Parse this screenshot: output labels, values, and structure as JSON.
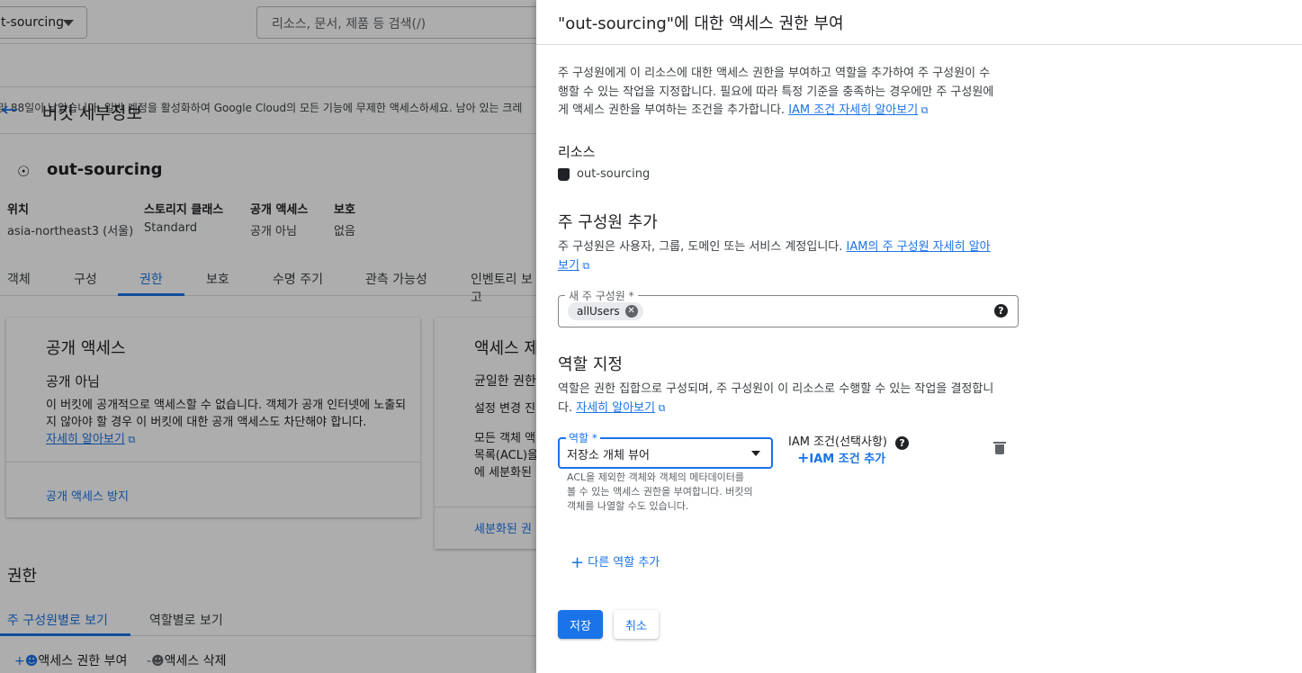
{
  "background": {
    "project_selector": "t-sourcing",
    "search_placeholder": "리소스, 문서, 제품 등 검색(/)",
    "trial_banner": "및 88일이 남았습니다. 일반 계정을 활성화하여 Google Cloud의 모든 기능에 무제한 액세스하세요. 남아 있는 크레",
    "page_title": "버킷 세부정보",
    "bucket_name": "out-sourcing",
    "info": [
      {
        "label": "위치",
        "value": "asia-northeast3 (서울)"
      },
      {
        "label": "스토리지 클래스",
        "value": "Standard"
      },
      {
        "label": "공개 액세스",
        "value": "공개 아님"
      },
      {
        "label": "보호",
        "value": "없음"
      }
    ],
    "tabs": [
      "객체",
      "구성",
      "권한",
      "보호",
      "수명 주기",
      "관측 가능성",
      "인벤토리 보고"
    ],
    "card1": {
      "title": "공개 액세스",
      "subtitle": "공개 아님",
      "body": "이 버킷에 공개적으로 액세스할 수 없습니다. 객체가 공개 인터넷에 노출되지 않아야 할 경우 이 버킷에 대한 공개 액세스도 차단해야 합니다.",
      "link": "자세히 알아보기",
      "action": "공개 액세스 방지"
    },
    "card2": {
      "title": "액세스 제",
      "subtitle": "균일한 권한",
      "line1": "설정 변경 진",
      "line2": "모든 객체 액",
      "line3": "목록(ACL)을",
      "line4": "에 세분화된",
      "action": "세분화된 권"
    },
    "permissions_title": "권한",
    "perm_tabs": [
      "주 구성원별로 보기",
      "역할별로 보기"
    ],
    "actions": [
      "액세스 권한 부여",
      "액세스 삭제"
    ]
  },
  "panel": {
    "title": "\"out-sourcing\"에 대한 액세스 권한 부여",
    "intro_line1": "주 구성원에게 이 리소스에 대한 액세스 권한을 부여하고 역할을 추가하여 주 구성원이 수",
    "intro_line2": "행할 수 있는 작업을 지정합니다. 필요에 따라 특정 기준을 충족하는 경우에만 주 구성원에",
    "intro_line3": "게 액세스 권한을 부여하는 조건을 추가합니다.",
    "intro_link": "IAM 조건 자세히 알아보기",
    "resource_heading": "리소스",
    "resource_name": "out-sourcing",
    "add_principal_heading": "주 구성원 추가",
    "principal_desc": "주 구성원은 사용자, 그룹, 도메인 또는 서비스 계정입니다.",
    "principal_link_1": "IAM의 주 구성원 자세히 알아",
    "principal_link_2": "보기",
    "new_principal_label": "새 주 구성원 *",
    "principal_chip": "allUsers",
    "assign_role_heading": "역할 지정",
    "role_desc_line1": "역할은 권한 집합으로 구성되며, 주 구성원이 이 리소스로 수행할 수 있는 작업을 결정합니",
    "role_desc_line2": "다.",
    "role_link": "자세히 알아보기",
    "role_label": "역할 *",
    "role_value": "저장소 개체 뷰어",
    "role_help": "ACL을 제외한 객체와 객체의 메타데이터를 볼 수 있는 액세스 권한을 부여합니다. 버킷의 객체를 나열할 수도 있습니다.",
    "iam_condition_label": "IAM 조건(선택사항)",
    "iam_condition_add": "IAM 조건 추가",
    "add_role": "다른 역할 추가",
    "save": "저장",
    "cancel": "취소"
  },
  "colors": {
    "accent": "#1a73e8",
    "overlay": "rgba(0,0,0,0.32)"
  }
}
